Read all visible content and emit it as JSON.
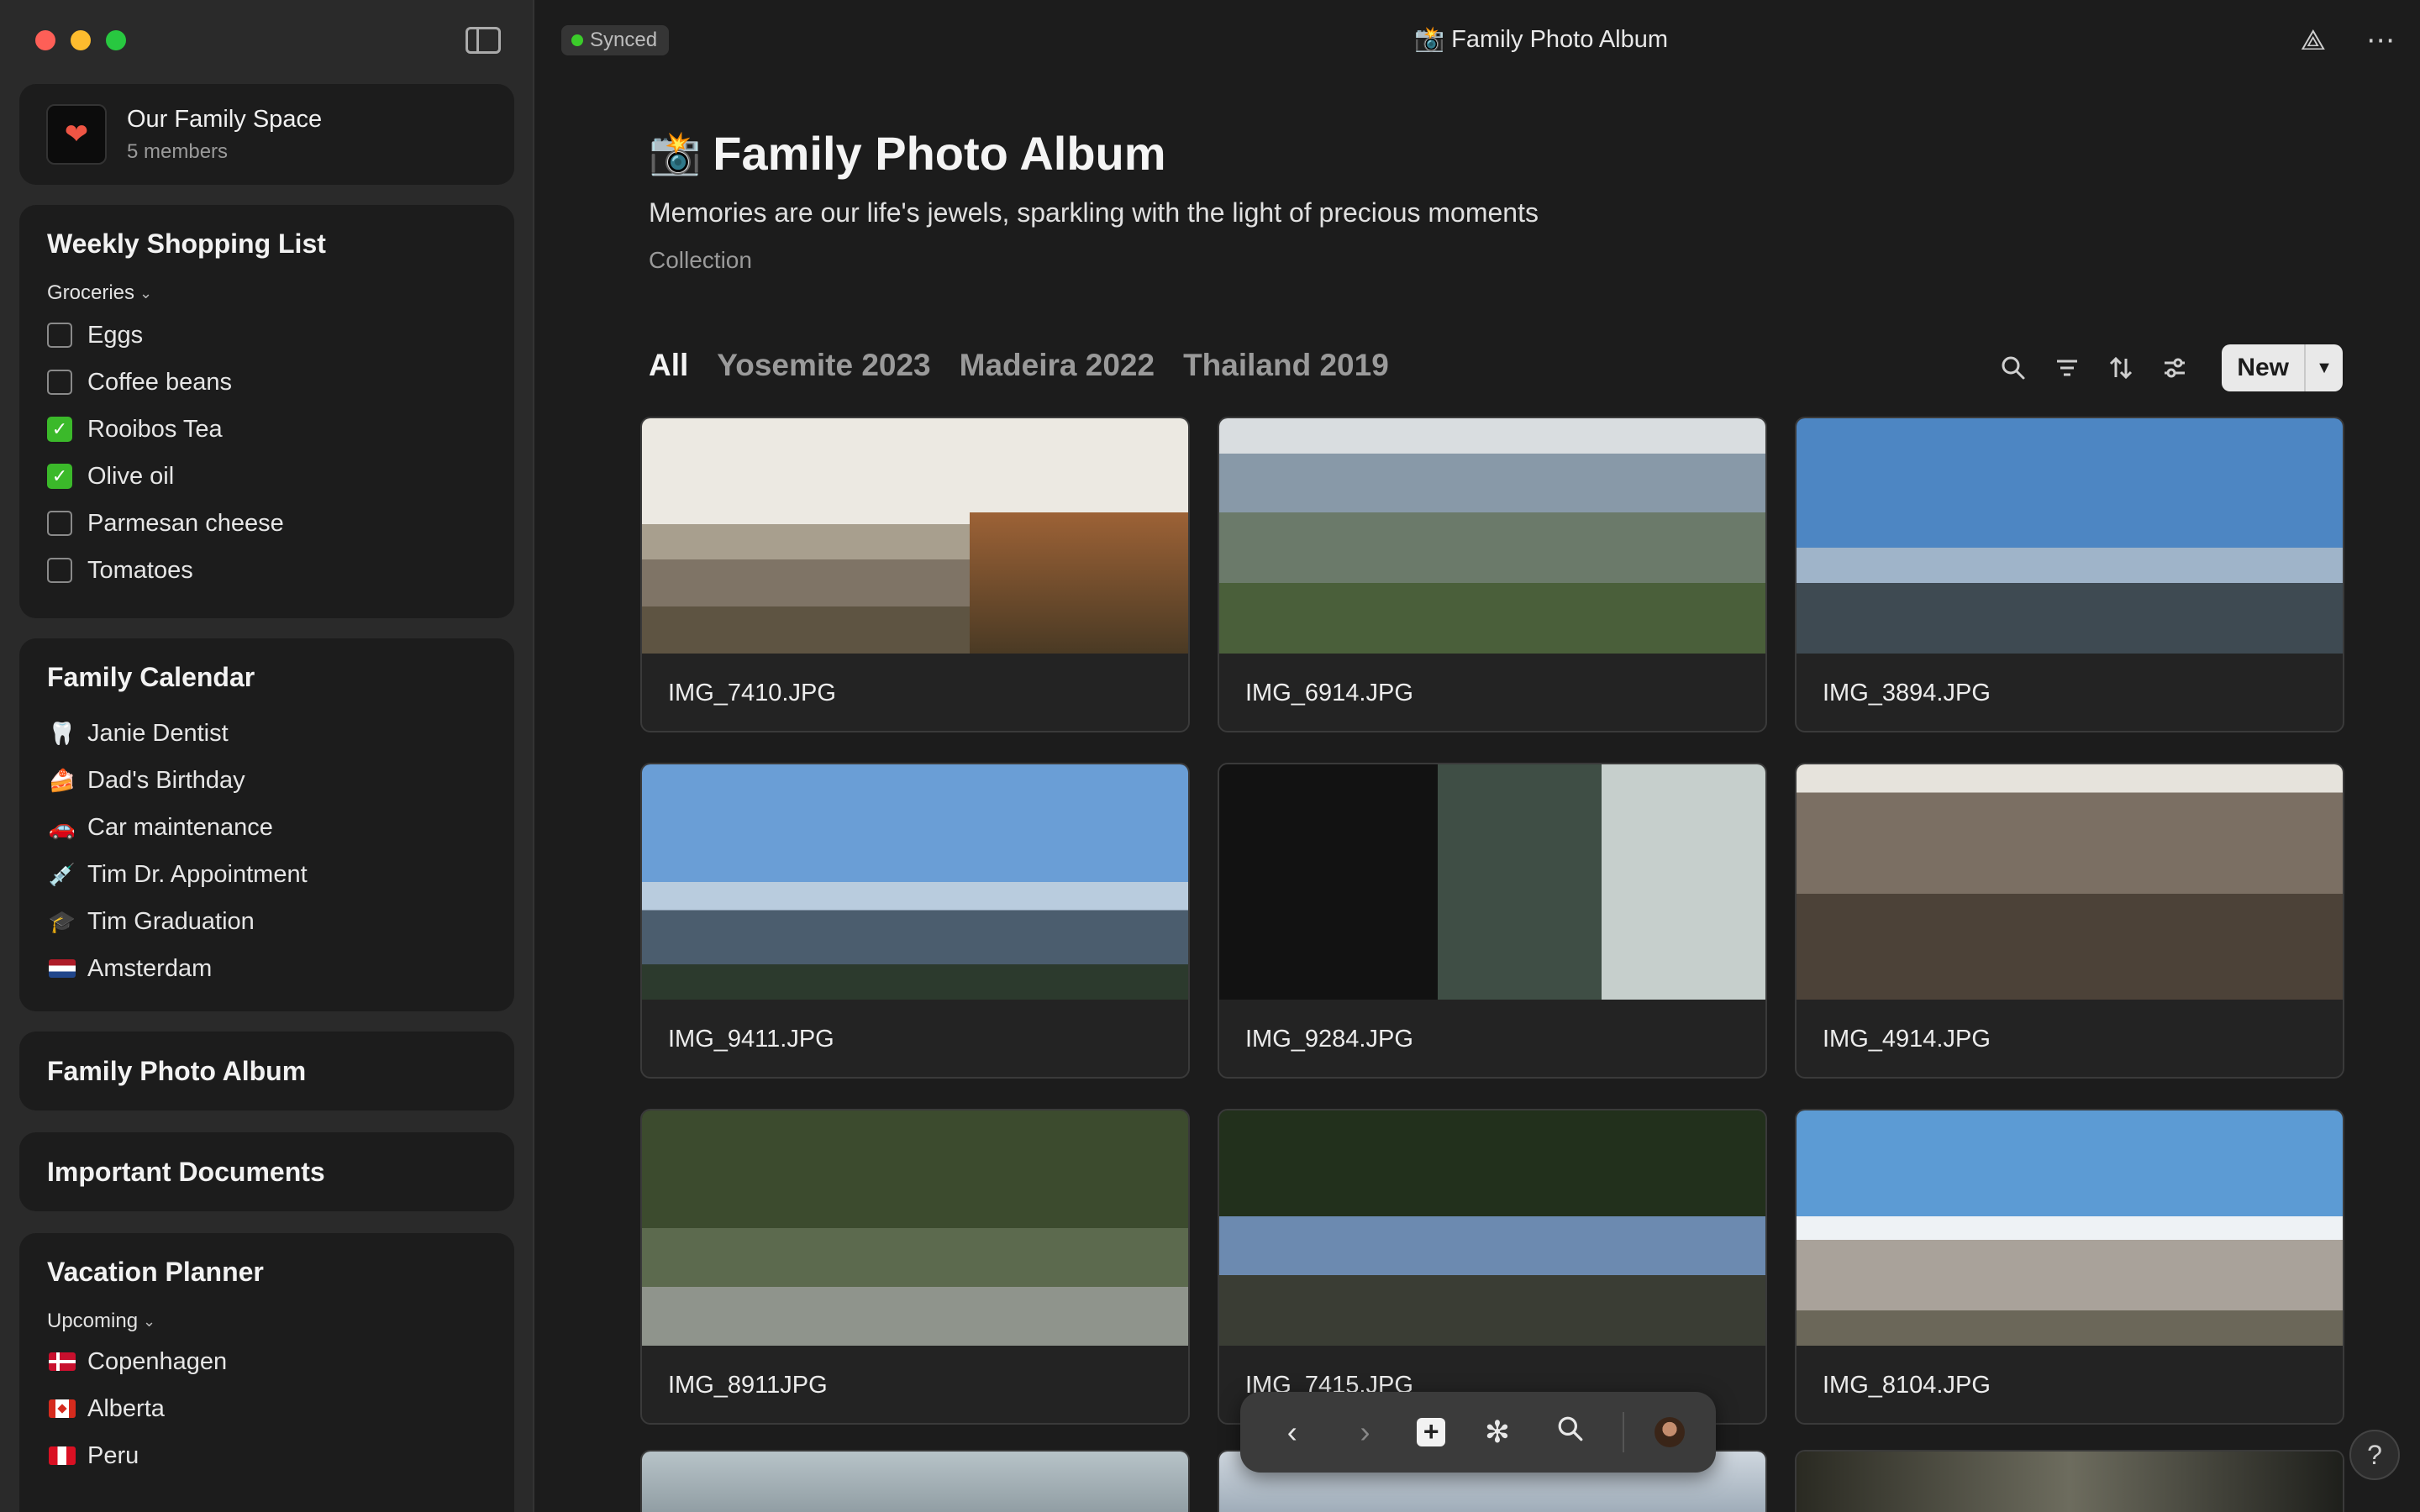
{
  "window": {
    "title": "📸 Family Photo Album"
  },
  "status": {
    "synced_label": "Synced"
  },
  "space": {
    "name": "Our Family Space",
    "members": "5 members",
    "avatar_icon": "heart-hand-icon"
  },
  "shopping": {
    "title": "Weekly Shopping List",
    "group": "Groceries",
    "items": [
      {
        "label": "Eggs",
        "checked": false
      },
      {
        "label": "Coffee beans",
        "checked": false
      },
      {
        "label": "Rooibos Tea",
        "checked": true
      },
      {
        "label": "Olive oil",
        "checked": true
      },
      {
        "label": "Parmesan cheese",
        "checked": false
      },
      {
        "label": "Tomatoes",
        "checked": false
      }
    ]
  },
  "calendar": {
    "title": "Family Calendar",
    "events": [
      {
        "emoji": "🦷",
        "label": "Janie Dentist"
      },
      {
        "emoji": "🍰",
        "label": "Dad's Birthday"
      },
      {
        "emoji": "🚗",
        "label": "Car maintenance"
      },
      {
        "emoji": "💉",
        "label": "Tim Dr. Appointment"
      },
      {
        "emoji": "🎓",
        "label": "Tim Graduation"
      },
      {
        "emoji": "flag-nl",
        "label": "Amsterdam"
      }
    ]
  },
  "album_card": {
    "title": "Family Photo Album"
  },
  "docs_card": {
    "title": "Important Documents"
  },
  "vacation": {
    "title": "Vacation Planner",
    "group": "Upcoming",
    "items": [
      {
        "flag": "flag-dk",
        "label": "Copenhagen"
      },
      {
        "flag": "flag-ca",
        "label": "Alberta"
      },
      {
        "flag": "flag-pe",
        "label": "Peru"
      }
    ]
  },
  "page": {
    "emoji": "📸",
    "title": "Family Photo Album",
    "description": "Memories are our life's jewels, sparkling with the light of precious moments",
    "type": "Collection"
  },
  "tabs": [
    "All",
    "Yosemite 2023",
    "Madeira 2022",
    "Thailand 2019"
  ],
  "toolbar": {
    "new_label": "New"
  },
  "photos": [
    "IMG_7410.JPG",
    "IMG_6914.JPG",
    "IMG_3894.JPG",
    "IMG_9411.JPG",
    "IMG_9284.JPG",
    "IMG_4914.JPG",
    "IMG_8911JPG",
    "IMG_7415.JPG",
    "IMG_8104.JPG"
  ],
  "help_label": "?"
}
